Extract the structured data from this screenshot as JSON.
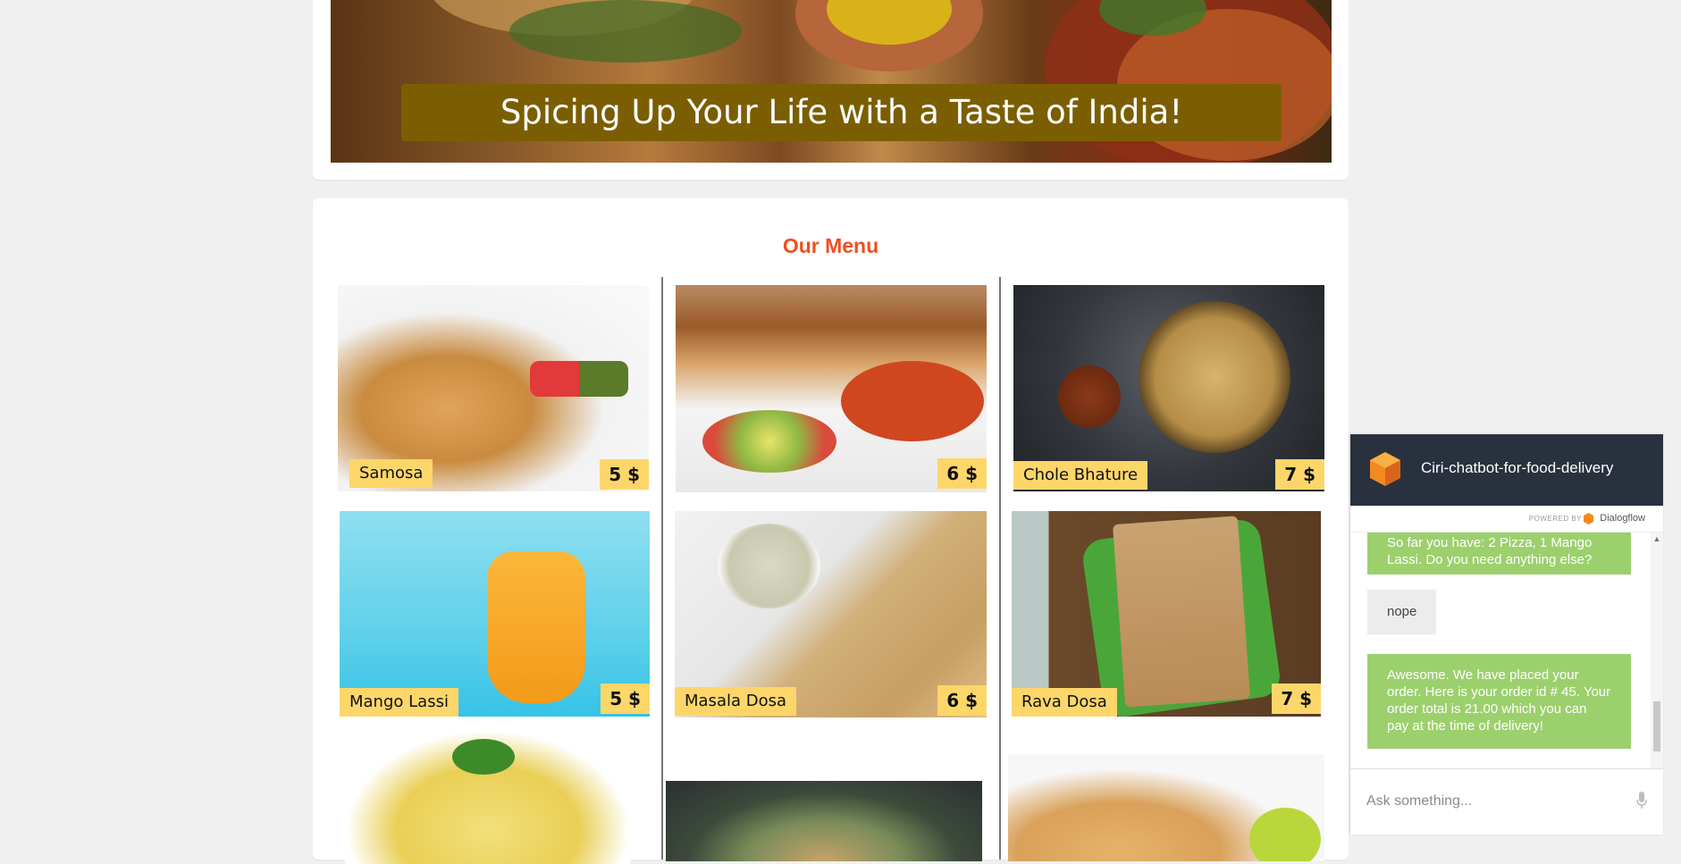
{
  "hero": {
    "banner_text": "Spicing Up Your Life with a Taste of India!"
  },
  "menu": {
    "title": "Our Menu",
    "items": [
      {
        "name": "Samosa",
        "price": "5 $"
      },
      {
        "name": "",
        "price": "6 $"
      },
      {
        "name": "Chole Bhature",
        "price": "7 $"
      },
      {
        "name": "Mango Lassi",
        "price": "5 $"
      },
      {
        "name": "Masala Dosa",
        "price": "6 $"
      },
      {
        "name": "Rava Dosa",
        "price": "7 $"
      }
    ]
  },
  "chat": {
    "title": "Ciri-chatbot-for-food-delivery",
    "powered_by": "POWERED BY",
    "provider": "Dialogflow",
    "messages": [
      {
        "from": "bot",
        "text": "So far you have: 2 Pizza, 1 Mango Lassi. Do you need anything else?"
      },
      {
        "from": "user",
        "text": "nope"
      },
      {
        "from": "bot",
        "text": "Awesome. We have placed your order. Here is your order id # 45. Your order total is 21.00 which you can pay at the time of delivery!"
      }
    ],
    "input_placeholder": "Ask something..."
  }
}
